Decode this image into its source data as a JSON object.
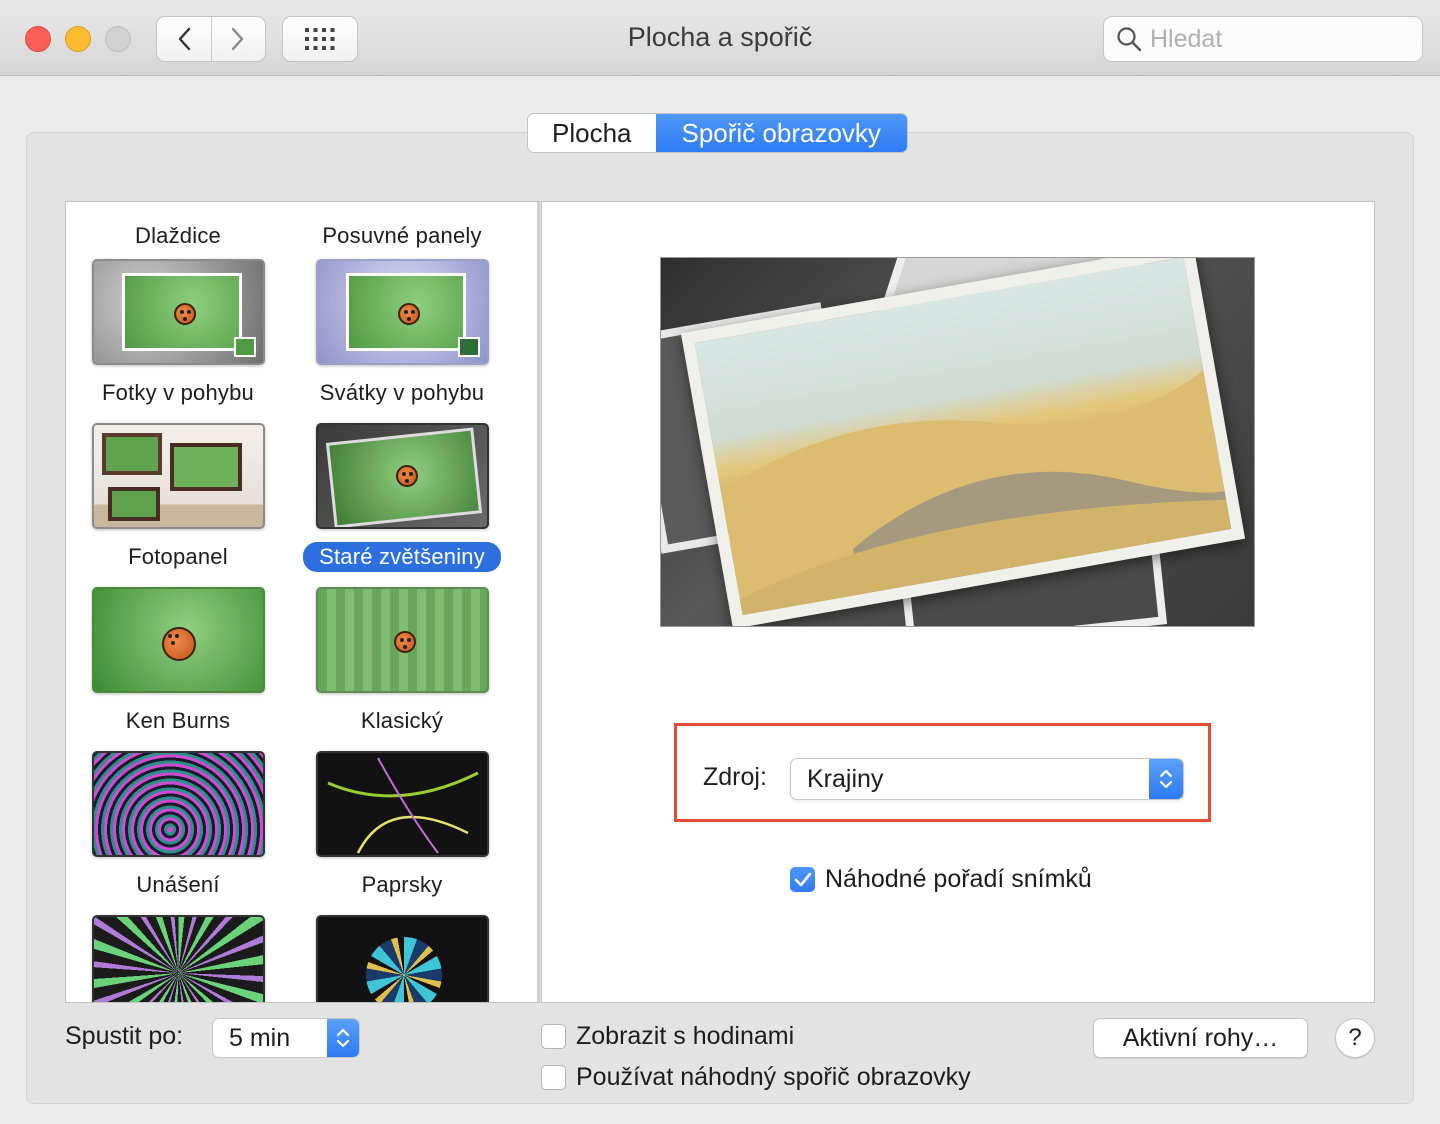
{
  "window": {
    "title": "Plocha a spořič"
  },
  "search": {
    "placeholder": "Hledat"
  },
  "tabs": [
    {
      "label": "Plocha",
      "active": false
    },
    {
      "label": "Spořič obrazovky",
      "active": true
    }
  ],
  "modules": [
    {
      "label": "Dlaždice",
      "selected": false
    },
    {
      "label": "Posuvné panely",
      "selected": false
    },
    {
      "label": "Fotky v pohybu",
      "selected": false
    },
    {
      "label": "Svátky v pohybu",
      "selected": false
    },
    {
      "label": "Fotopanel",
      "selected": false
    },
    {
      "label": "Staré zvětšeniny",
      "selected": true
    },
    {
      "label": "Ken Burns",
      "selected": false
    },
    {
      "label": "Klasický",
      "selected": false
    },
    {
      "label": "Unášení",
      "selected": false
    },
    {
      "label": "Paprsky",
      "selected": false
    }
  ],
  "options": {
    "source_label": "Zdroj:",
    "source_value": "Krajiny",
    "shuffle_label": "Náhodné pořadí snímků",
    "shuffle_checked": true
  },
  "bottom": {
    "start_label": "Spustit po:",
    "start_value": "5 min",
    "show_clock_label": "Zobrazit s hodinami",
    "show_clock_checked": false,
    "random_saver_label": "Používat náhodný spořič obrazovky",
    "random_saver_checked": false,
    "hot_corners_label": "Aktivní rohy…",
    "help_label": "?"
  },
  "colors": {
    "accent": "#2f7df3",
    "selection": "#2e6fe0",
    "highlight_box": "#e64a30"
  }
}
